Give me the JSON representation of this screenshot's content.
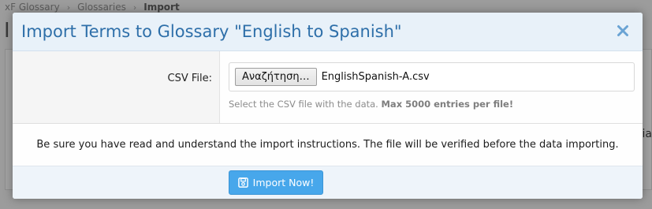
{
  "background": {
    "breadcrumb": [
      "xF Glossary",
      "Glossaries",
      "Import"
    ],
    "heading_fragment": "I",
    "right_fragment": "ia"
  },
  "modal": {
    "title": "Import Terms to Glossary \"English to Spanish\"",
    "close_icon": "close-icon",
    "csv_label": "CSV File:",
    "browse_label": "Αναζήτηση…",
    "file_name": "EnglishSpanish-A.csv",
    "hint_prefix": "Select the CSV file with the data.",
    "hint_bold": "Max 5000 entries per file!",
    "notice": "Be sure you have read and understand the import instructions. The file will be verified before the data importing.",
    "import_button": "Import Now!",
    "import_icon": "save-icon"
  },
  "colors": {
    "title": "#2e6fa9",
    "header_bg": "#e8f1f9",
    "button_bg": "#47a7eb"
  }
}
